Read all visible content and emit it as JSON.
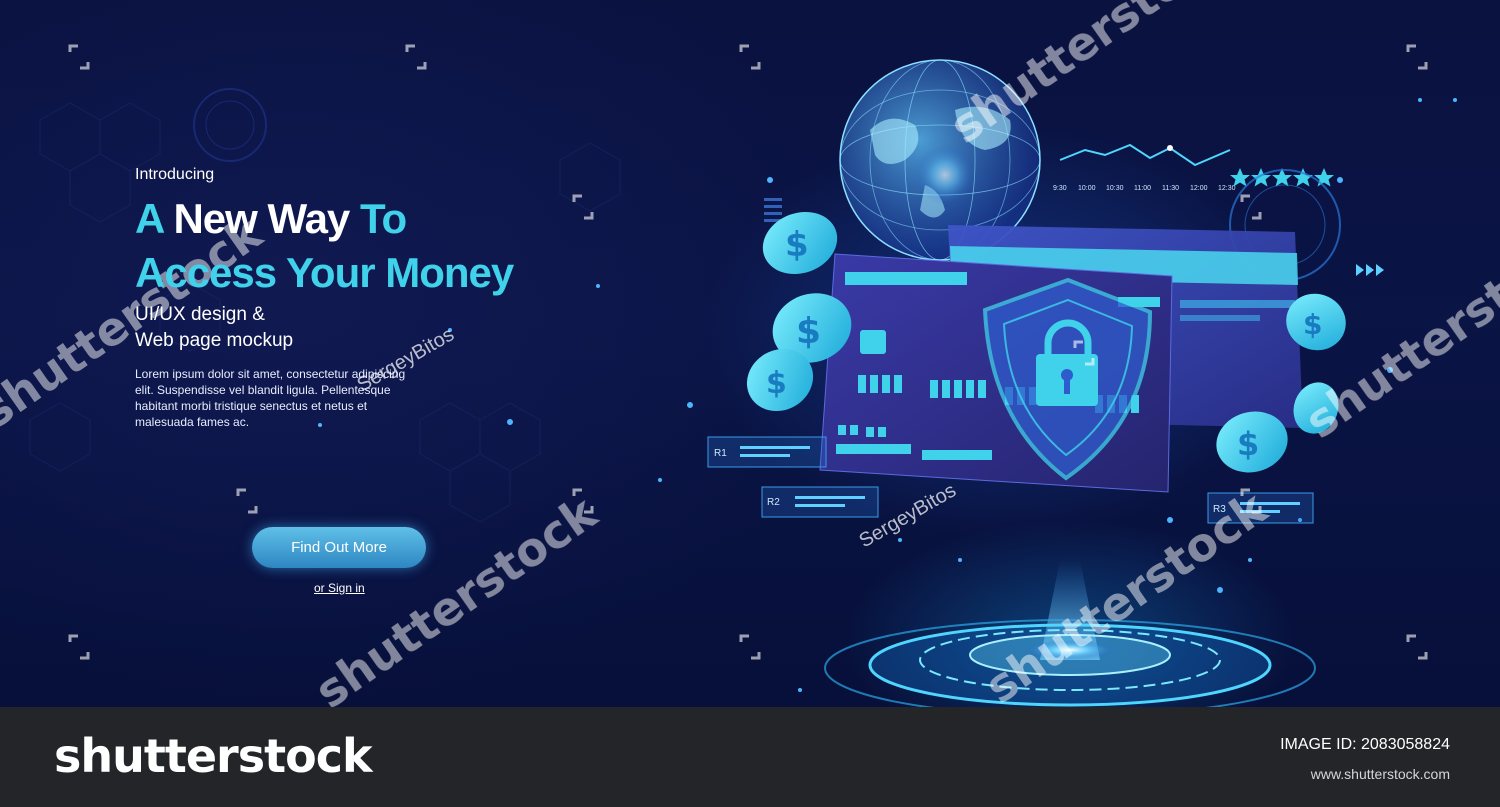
{
  "hero": {
    "intro": "Introducing",
    "headline_line1_part1": "A",
    "headline_line1_part2": "New Way",
    "headline_line1_part3": "To",
    "headline_line2": "Access Your Money",
    "subtitle_line1": "UI/UX design  &",
    "subtitle_line2": "Web page mockup",
    "body_text": "Lorem ipsum dolor sit amet, consectetur adipiscing elit. Suspendisse vel blandit ligula. Pellentesque habitant morbi tristique senectus et netus et malesuada fames ac.",
    "cta_label": "Find Out More",
    "signin_label": "or Sign in"
  },
  "illustration": {
    "card_labels": [
      "R1",
      "R2",
      "R3"
    ],
    "chart_times": [
      "9:30",
      "10:00",
      "10:30",
      "11:00",
      "11:30",
      "12:00",
      "12:30"
    ],
    "rating_stars": 5,
    "icons": [
      "globe-icon",
      "credit-card-icon",
      "shield-lock-icon",
      "dollar-coin-icon",
      "hologram-platform-icon",
      "line-chart-icon",
      "star-icon"
    ],
    "accent_color": "#3fd2ea",
    "background_color": "#0a1240"
  },
  "watermark": {
    "text": "shutterstock",
    "author": "SergeyBitos"
  },
  "footer": {
    "logo": "shutterstock",
    "image_id": "IMAGE ID: 2083058824",
    "url": "www.shutterstock.com",
    "background_color": "#232529"
  }
}
